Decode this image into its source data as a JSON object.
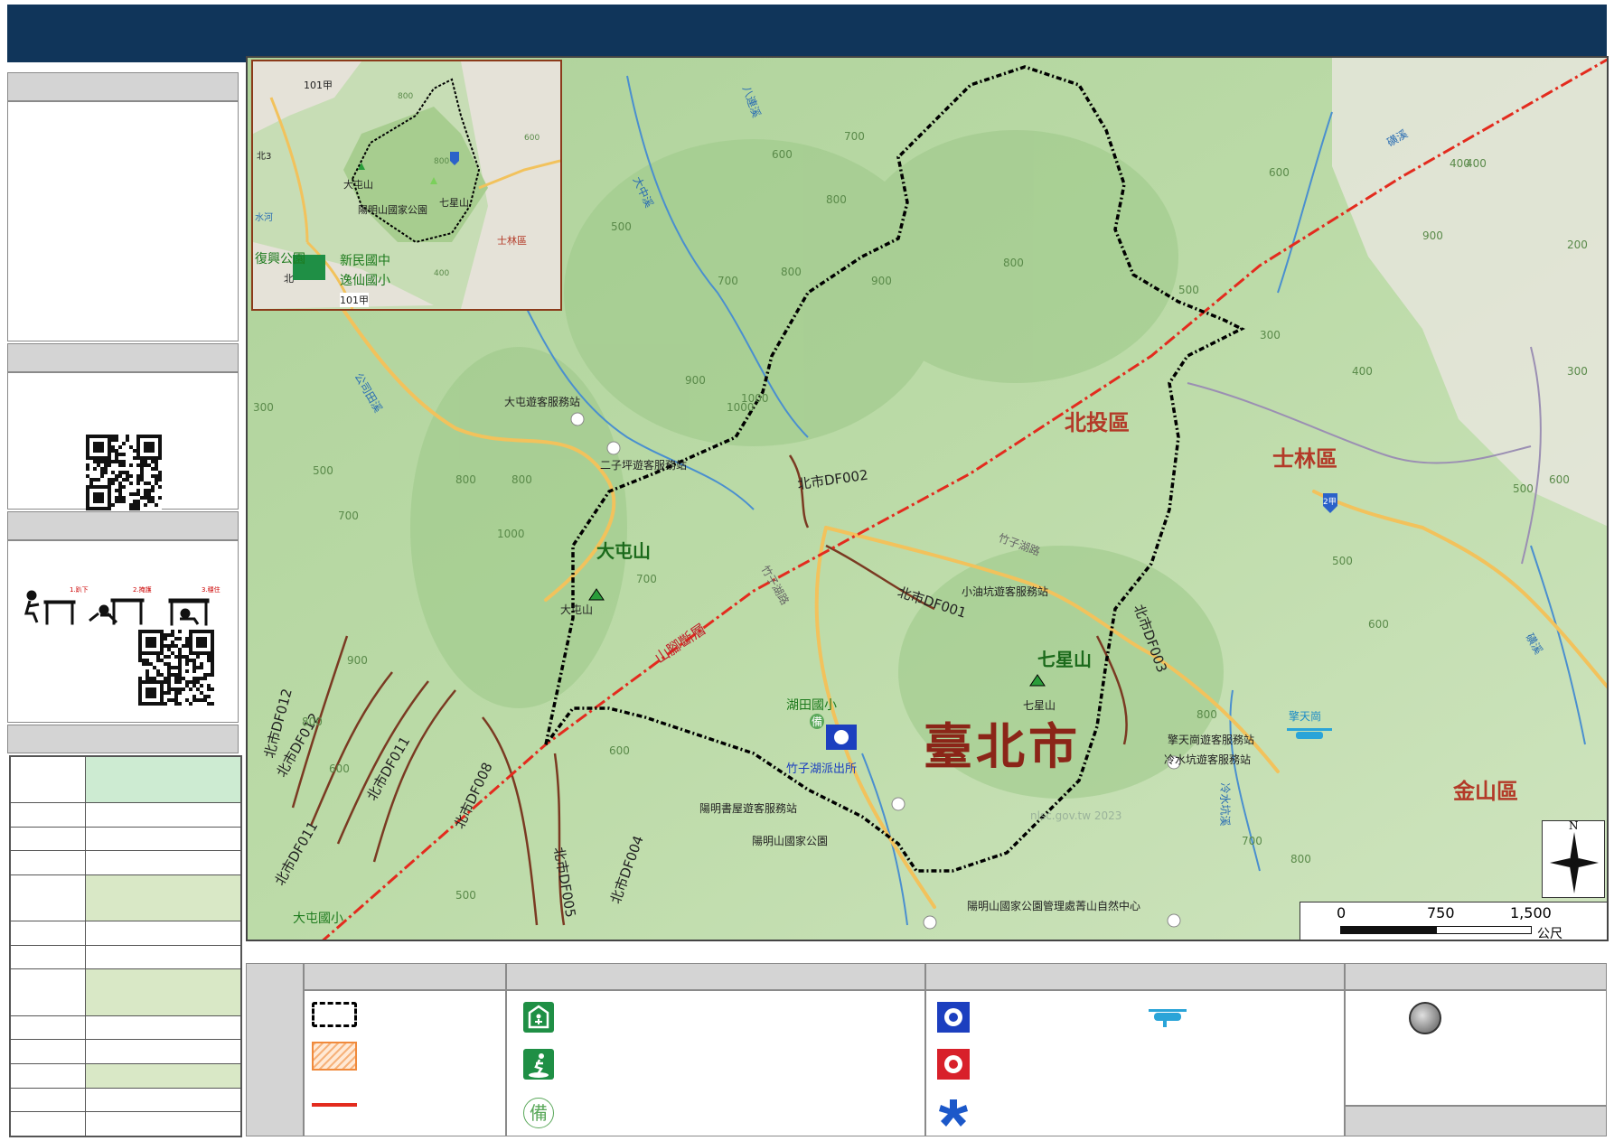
{
  "header": {
    "title": ""
  },
  "map": {
    "labels": {
      "taipei_city": "臺北市",
      "beitou": "北投區",
      "shilin": "士林區",
      "jinshan": "金山區",
      "datun_mtn": "大屯山",
      "datun_mtn_small": "大屯山",
      "qixing_mtn": "七星山",
      "qixing_mtn_small": "七星山",
      "fault": "山腳斷層",
      "zhuzihu_rd": "竹子湖路",
      "zhuzihu_rd2": "竹子湖路",
      "datun_visitor": "大屯遊客服務站",
      "erziping_visitor": "二子坪遊客服務站",
      "youkeng_visitor": "小油坑遊客服務站",
      "qingtianang_visitor": "擎天崗遊客服務站",
      "qingtianang": "擎天崗",
      "lengshuikeng_visitor": "冷水坑遊客服務站",
      "yangming_bookhouse": "陽明書屋遊客服務站",
      "yangmingshan_park": "陽明山國家公園",
      "yangmingshan_hq": "陽明山國家公園管理處菁山自然中心",
      "hutian_school": "湖田國小",
      "zhuzihu_police": "竹子湖派出所",
      "datun_school": "大屯國小",
      "shuimu": "備",
      "df001": "北市DF001",
      "df002": "北市DF002",
      "df003": "北市DF003",
      "df004": "北市DF004",
      "df005": "北市DF005",
      "df008": "北市DF008",
      "df011": "北市DF011",
      "df011b": "北市DF011",
      "df012": "北市DF012",
      "df012b": "北市DF012",
      "bagou": "八連溪",
      "dazhong": "大中溪",
      "gongsi": "公司田溪",
      "lengshuikeng_creek": "冷水坑溪",
      "mingde_creek": "磺溪",
      "shilinxi": "磺溪",
      "route2": "2甲",
      "watermark": "nlsc.gov.tw 2023",
      "c800a": "800",
      "c700a": "700",
      "c600a": "600",
      "c500a": "500",
      "c900a": "900",
      "c800b": "800",
      "c700b": "700",
      "c1000": "1000",
      "c900b": "900",
      "c800c": "800",
      "c600b": "600",
      "c500b": "500",
      "c400a": "400",
      "c300a": "300",
      "c200a": "200",
      "c500c": "500",
      "c600c": "600",
      "c700c": "700",
      "c800d": "800",
      "c1000b": "1000",
      "c900c": "900",
      "c800e": "800",
      "c300b": "300",
      "c500d": "500",
      "c700d": "700",
      "c600d": "600",
      "c800f": "800",
      "c400b": "400",
      "c700e": "700",
      "c800g": "800",
      "c600e": "600",
      "c500e": "500",
      "c600f": "600",
      "c900d": "900",
      "c800h": "800",
      "c500f": "500",
      "c300c": "300",
      "c400c": "400",
      "c1000c": "1000"
    },
    "inset": {
      "road101": "101甲",
      "road101b": "101甲",
      "north3": "北3",
      "datun": "大屯山",
      "qixing": "七星山",
      "park": "陽明山國家公園",
      "shilin": "士林區",
      "fuxing_park": "復興公園",
      "xinmin_school": "新民國中",
      "yixian_school": "逸仙國小",
      "north": "北",
      "water": "水河",
      "c800": "800",
      "c800b": "800",
      "c600": "600",
      "c400": "400"
    },
    "compass_n": "N",
    "scale": {
      "t0": "0",
      "t1": "750",
      "t2": "1,500",
      "unit": "公尺"
    }
  },
  "left_panel": {
    "evac_diagram": {
      "drop": "1.趴下",
      "cover": "2.掩護",
      "hold": "3.穩住"
    }
  },
  "legend": {
    "colors": {
      "boundary": "#000000",
      "zone": "#f08a3c",
      "fault": "#e32b1e"
    }
  },
  "colors": {
    "header": "#10355a",
    "land": "#b9d9a6",
    "road": "#f2c25c",
    "river": "#4a8fcf",
    "district": "#b33a28"
  }
}
